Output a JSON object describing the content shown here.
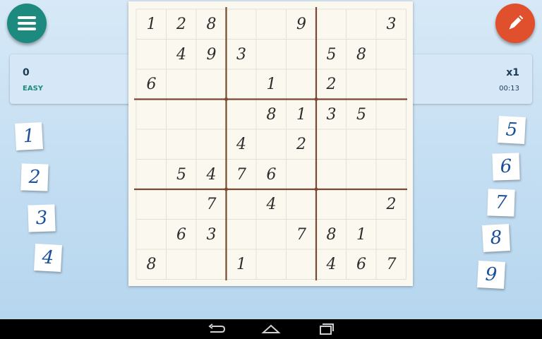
{
  "header": {
    "menu_icon": "hamburger-menu-icon",
    "pencil_icon": "pencil-icon"
  },
  "status": {
    "score": "0",
    "difficulty": "EASY",
    "multiplier": "x1",
    "timer": "00:13"
  },
  "board": {
    "rows": [
      [
        "1",
        "2",
        "8",
        "",
        "",
        "9",
        "",
        "",
        "3"
      ],
      [
        "",
        "4",
        "9",
        "3",
        "",
        "",
        "5",
        "8",
        ""
      ],
      [
        "6",
        "",
        "",
        "",
        "1",
        "",
        "2",
        "",
        ""
      ],
      [
        "",
        "",
        "",
        "",
        "8",
        "1",
        "3",
        "5",
        ""
      ],
      [
        "",
        "",
        "",
        "4",
        "",
        "2",
        "",
        "",
        ""
      ],
      [
        "",
        "5",
        "4",
        "7",
        "6",
        "",
        "",
        "",
        ""
      ],
      [
        "",
        "",
        "7",
        "",
        "4",
        "",
        "",
        "",
        "2"
      ],
      [
        "",
        "6",
        "3",
        "",
        "",
        "7",
        "8",
        "1",
        ""
      ],
      [
        "8",
        "",
        "",
        "1",
        "",
        "",
        "4",
        "6",
        "7"
      ]
    ]
  },
  "number_tiles": {
    "left": [
      "1",
      "2",
      "3",
      "4"
    ],
    "right": [
      "5",
      "6",
      "7",
      "8",
      "9"
    ]
  },
  "colors": {
    "menu_button": "#1c8a7e",
    "pencil_button": "#e0502d",
    "grid_thick": "#7a4a30",
    "tile_digit": "#1a4f9a",
    "difficulty_text": "#1d8a80"
  },
  "navbar": {
    "back_icon": "back-icon",
    "home_icon": "home-icon",
    "recents_icon": "recents-icon"
  }
}
